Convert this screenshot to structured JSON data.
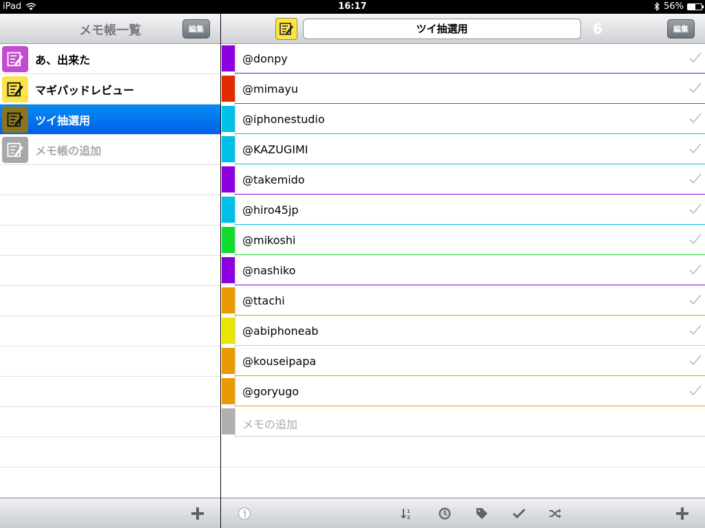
{
  "status": {
    "device": "iPad",
    "time": "16:17",
    "battery": "56%",
    "battery_level": 0.56
  },
  "left": {
    "title": "メモ帳一覧",
    "edit_label": "編集",
    "notebooks": [
      {
        "label": "あ、出来た",
        "color": "#c44bd1",
        "selected": false
      },
      {
        "label": "マギパッドレビュー",
        "color": "#fbe34a",
        "selected": false
      },
      {
        "label": "ツイ抽選用",
        "color": "#8a7420",
        "selected": true
      }
    ],
    "add_label": "メモ帳の追加"
  },
  "right": {
    "title": "ツイ抽選用",
    "count": "6",
    "edit_label": "編集",
    "memos": [
      {
        "text": "@donpy",
        "color": "#8e00e0"
      },
      {
        "text": "@mimayu",
        "color": "#e02a00"
      },
      {
        "text": "@iphonestudio",
        "color": "#00bfe8"
      },
      {
        "text": "@KAZUGIMI",
        "color": "#00bfe8"
      },
      {
        "text": "@takemido",
        "color": "#8e00e0"
      },
      {
        "text": "@hiro45jp",
        "color": "#00bfe8"
      },
      {
        "text": "@mikoshi",
        "color": "#10dc30"
      },
      {
        "text": "@nashiko",
        "color": "#8e00e0"
      },
      {
        "text": "@ttachi",
        "color": "#e89a00"
      },
      {
        "text": "@abiphoneab",
        "color": "#e6e600"
      },
      {
        "text": "@kouseipapa",
        "color": "#e89a00"
      },
      {
        "text": "@goryugo",
        "color": "#e89a00"
      }
    ],
    "add_label": "メモの追加",
    "add_color": "#b0b0b0"
  }
}
